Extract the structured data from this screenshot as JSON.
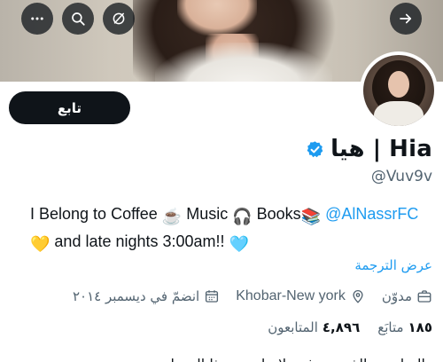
{
  "header_buttons": {
    "back_icon": "arrow-right-icon",
    "more_icon": "more-horizontal-icon",
    "search_icon": "search-icon",
    "grok_icon": "slash-circle-icon"
  },
  "profile": {
    "follow_label": "تابع",
    "display_name": "هيا | Hia",
    "verified": true,
    "verified_color": "#1d9bf0",
    "handle": "@Vuv9v",
    "bio_line1_text": "I Belong to Coffee ",
    "bio_coffee_emoji": "☕",
    "bio_music_text": " Music ",
    "bio_headphones_emoji": "🎧",
    "bio_books_text": " Books",
    "bio_books_emoji": "📚",
    "bio_mention": " @AlNassrFC",
    "bio_yellow_heart": "💛",
    "bio_line2_text": " and late nights 3:00am!! ",
    "bio_blue_heart": "🩵",
    "translate_label": "عرض الترجمة",
    "category": "مدوّن",
    "location": "Khobar-New york",
    "joined": "انضمّ في ديسمبر ٢٠١٤",
    "following_count": "١٨٥",
    "following_label": "متابَع",
    "followers_count": "٤,٨٩٦",
    "followers_label": "المتابعون",
    "cutoff_text": "المتابعون الذين تعرفهم لا يتابعون هذا الحساب"
  },
  "colors": {
    "accent": "#1d9bf0",
    "text_primary": "#0f1419",
    "text_secondary": "#536471"
  }
}
